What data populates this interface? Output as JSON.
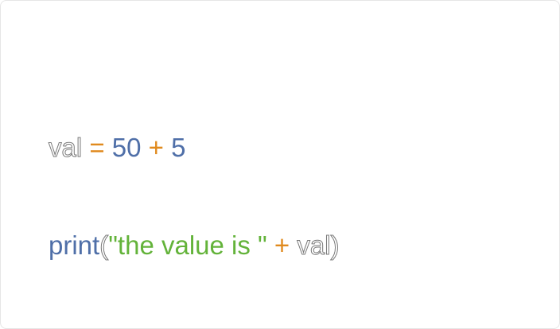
{
  "code": {
    "line1": {
      "var": "val",
      "op_assign": " = ",
      "num1": "50",
      "op_plus": " + ",
      "num2": "5"
    },
    "line2": {
      "fn": "print",
      "paren_open": "(",
      "string": "\"the value is \"",
      "op_plus": " + ",
      "var": "val",
      "paren_close": ")"
    }
  },
  "colors": {
    "operator": "#e08a1e",
    "number": "#4f6fa8",
    "function": "#4f6fa8",
    "string": "#63b33a",
    "identifier_outline": "#7a7a7a",
    "background": "#ffffff"
  }
}
